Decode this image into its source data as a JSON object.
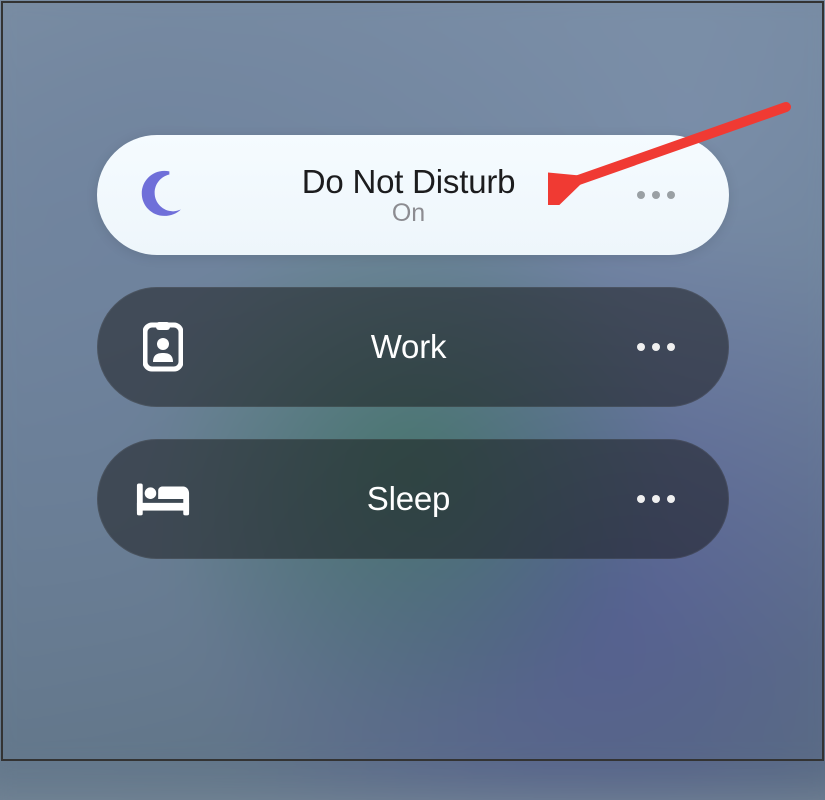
{
  "focus_modes": [
    {
      "id": "dnd",
      "label": "Do Not Disturb",
      "status": "On",
      "active": true,
      "icon": "moon"
    },
    {
      "id": "work",
      "label": "Work",
      "active": false,
      "icon": "badge"
    },
    {
      "id": "sleep",
      "label": "Sleep",
      "active": false,
      "icon": "bed"
    }
  ],
  "colors": {
    "moon_icon": "#6f6fd9",
    "active_title": "#1c1c1e",
    "inactive_title": "#ffffff",
    "subtitle": "#8c8c91",
    "annotation": "#f03a33"
  }
}
